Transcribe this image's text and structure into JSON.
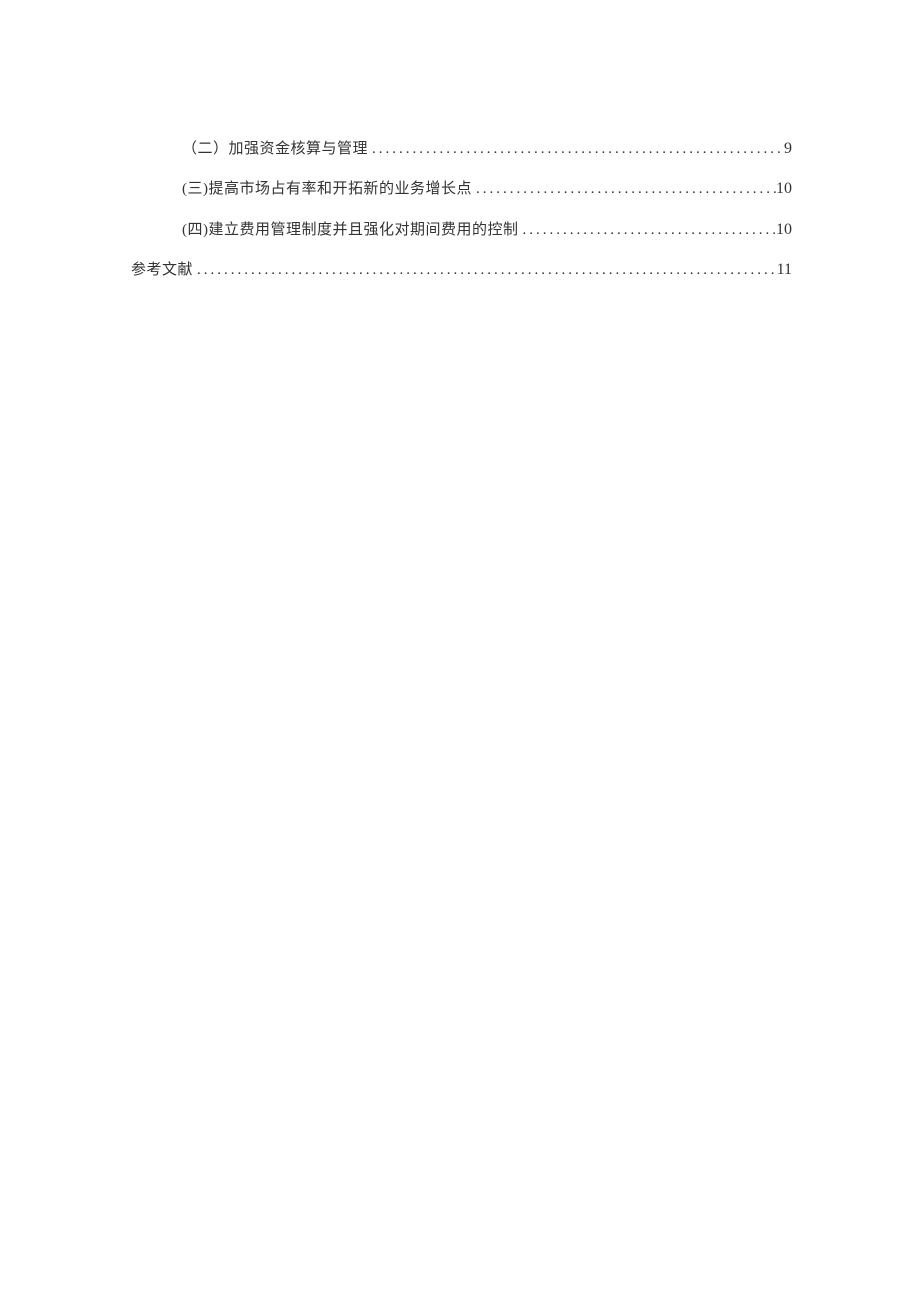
{
  "toc": {
    "entries": [
      {
        "indent": 1,
        "title": "（二）加强资金核算与管理",
        "page": "9"
      },
      {
        "indent": 1,
        "title": "(三)提高市场占有率和开拓新的业务增长点",
        "page": "10"
      },
      {
        "indent": 1,
        "title": "(四)建立费用管理制度并且强化对期间费用的控制",
        "page": "10"
      },
      {
        "indent": 0,
        "title": "参考文献",
        "page": "11"
      }
    ]
  }
}
